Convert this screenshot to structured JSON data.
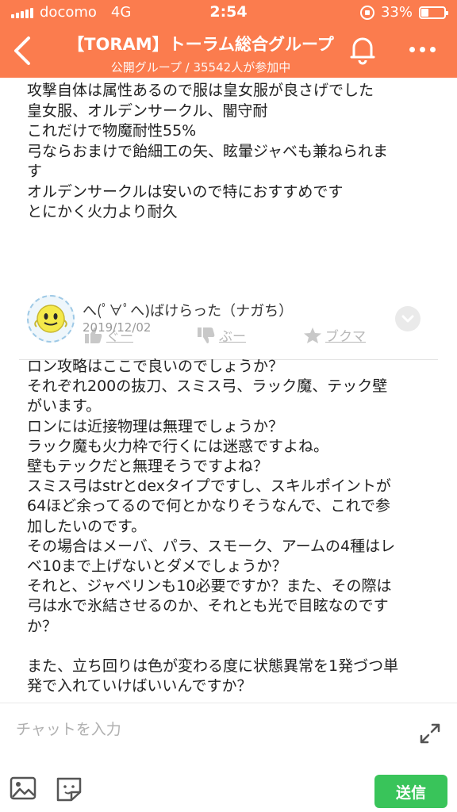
{
  "status_bar": {
    "carrier": "docomo",
    "network": "4G",
    "time": "2:54",
    "battery": "33%",
    "battery_level": 0.33
  },
  "header": {
    "title": "【TORAM】トーラム総合グループ",
    "subtitle": "公開グループ / 35542人が参加中",
    "back_icon": "chevron-left-icon",
    "bell_icon": "bell-icon",
    "more_icon": "more-icon",
    "color": "#fb7c4e"
  },
  "previous_post": {
    "text": "攻撃自体は属性あるので服は皇女服が良さげでした\n皇女服、オルデンサークル、闇守耐\nこれだけで物魔耐性55%\n弓ならおまけで飴細工の矢、眩暈ジャベも兼ねられま\nす\nオルデンサークルは安いので特におすすめです\nとにかく火力より耐久",
    "reactions": {
      "good": "ぐー",
      "boo": "ぶー",
      "bookmark": "ブクマ"
    }
  },
  "post": {
    "author": "へ(ﾟ∀ﾟへ)ばけらった（ナガち）",
    "date": "2019/12/02",
    "text": "ロン攻略はここで良いのでしょうか？\nそれぞれ200の抜刀、スミス弓、ラック魔、テック壁\nがいます。\nロンには近接物理は無理でしょうか？\nラック魔も火力枠で行くには迷惑ですよね。\n壁もテックだと無理そうですよね？\nスミス弓はstrとdexタイプですし、スキルポイントが\n64ほど余ってるので何とかなりそうなんで、これで参\n加したいのです。\nその場合はメーバ、パラ、スモーク、アームの4種はレ\nベ10まで上げないとダメでしょうか？\nそれと、ジャベリンも10必要ですか？また、その際は\n弓は水で氷結させるのか、それとも光で目眩なのです\nか？\n\nまた、立ち回りは色が変わる度に状態異常を1発づつ単\n発で入れていけばいいんですか？"
  },
  "input": {
    "placeholder": "チャットを入力",
    "send_label": "送信",
    "send_color": "#39c45a"
  }
}
